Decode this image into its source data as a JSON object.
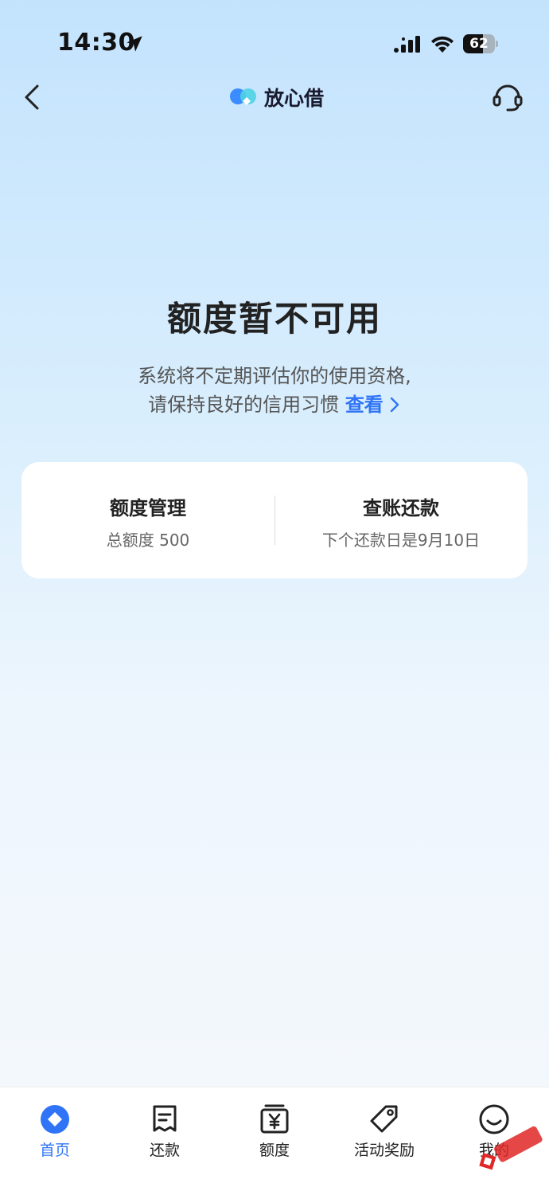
{
  "status_bar": {
    "time": "14:30",
    "battery_level": "62",
    "battery_fraction": 0.62
  },
  "nav": {
    "brand_name": "放心借"
  },
  "main": {
    "headline": "额度暂不可用",
    "desc_line1": "系统将不定期评估你的使用资格,",
    "desc_line2": "请保持良好的信用习惯",
    "view_link": "查看"
  },
  "card": {
    "left_title": "额度管理",
    "left_sub": "总额度 500",
    "right_title": "查账还款",
    "right_sub": "下个还款日是9月10日"
  },
  "tabs": [
    {
      "label": "首页",
      "icon": "home-diamond-icon",
      "active": true
    },
    {
      "label": "还款",
      "icon": "bill-icon",
      "active": false
    },
    {
      "label": "额度",
      "icon": "yuan-box-icon",
      "active": false
    },
    {
      "label": "活动奖励",
      "icon": "tag-icon",
      "active": false
    },
    {
      "label": "我的",
      "icon": "smiley-icon",
      "active": false
    }
  ],
  "colors": {
    "accent": "#2f74f6",
    "text": "#222222",
    "subtext": "#666666"
  }
}
